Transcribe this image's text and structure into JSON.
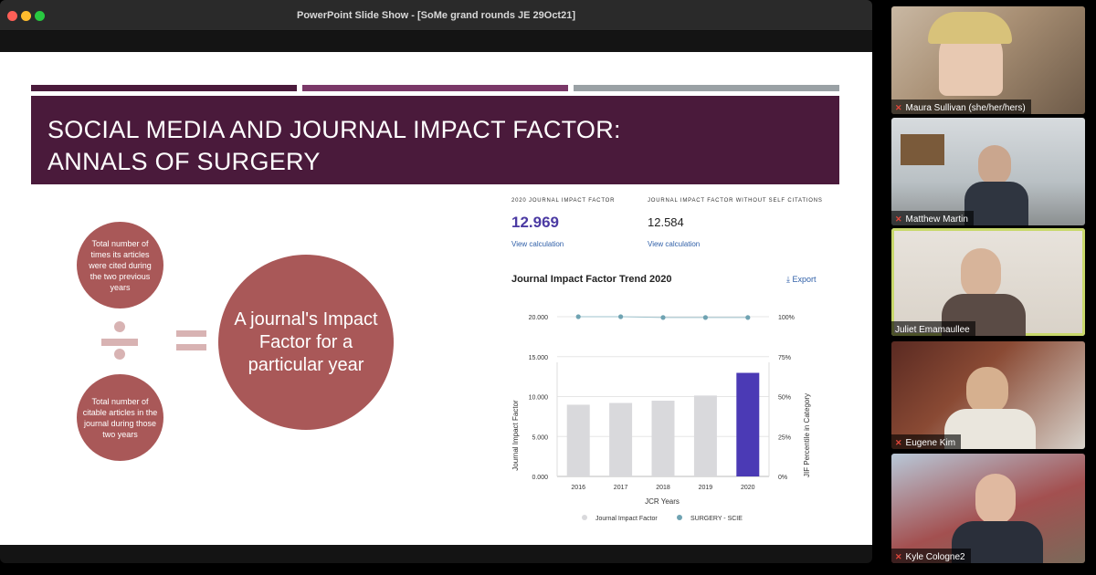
{
  "window": {
    "title": "PowerPoint Slide Show - [SoMe grand rounds JE 29Oct21]"
  },
  "slide": {
    "title_lines": [
      "SOCIAL MEDIA AND JOURNAL IMPACT FACTOR:",
      "ANNALS OF SURGERY"
    ],
    "numerator_text": "Total number of times its articles were cited during the two previous years",
    "denominator_text": "Total number of citable articles in the journal during those two years",
    "result_text": "A journal's Impact Factor for a particular year",
    "metrics": {
      "jif_label": "2020 JOURNAL IMPACT FACTOR",
      "jif_value": "12.969",
      "jif_link": "View calculation",
      "noself_label": "JOURNAL IMPACT FACTOR WITHOUT SELF CITATIONS",
      "noself_value": "12.584",
      "noself_link": "View calculation"
    },
    "chart_heading": "Journal Impact Factor Trend 2020",
    "export_label": "Export",
    "export_icon": "download-icon"
  },
  "chart_data": {
    "type": "bar",
    "categories": [
      "2016",
      "2017",
      "2018",
      "2019",
      "2020"
    ],
    "series": [
      {
        "name": "Journal Impact Factor",
        "values": [
          8.98,
          9.2,
          9.48,
          10.13,
          12.969
        ],
        "color": "#d9d9dc",
        "highlight_color": "#4b3ab5"
      },
      {
        "name": "SURGERY - SCIE",
        "values": [
          100,
          100,
          99.5,
          99.5,
          99.5
        ],
        "axis": "right",
        "color": "#6fa3b2"
      }
    ],
    "xlabel": "JCR Years",
    "ylabel": "Journal Impact Factor",
    "ylabel_right": "JIF Percentile in Category",
    "y_ticks": [
      "0.000",
      "5.000",
      "10.000",
      "15.000",
      "20.000"
    ],
    "y_right_ticks": [
      "0%",
      "25%",
      "50%",
      "75%",
      "100%"
    ],
    "ylim": [
      0,
      20
    ],
    "ylim_right": [
      0,
      100
    ],
    "legend_position": "bottom"
  },
  "participants": [
    {
      "name": "Maura Sullivan (she/her/hers)",
      "muted": true
    },
    {
      "name": "Matthew Martin",
      "muted": true
    },
    {
      "name": "Juliet Emamaullee",
      "muted": false,
      "active": true
    },
    {
      "name": "Eugene Kim",
      "muted": true
    },
    {
      "name": "Kyle Cologne2",
      "muted": true
    }
  ],
  "colors": {
    "slide_accent": "#4a1a3b",
    "circle": "#a95858",
    "speaking_border": "#c8d86b"
  }
}
